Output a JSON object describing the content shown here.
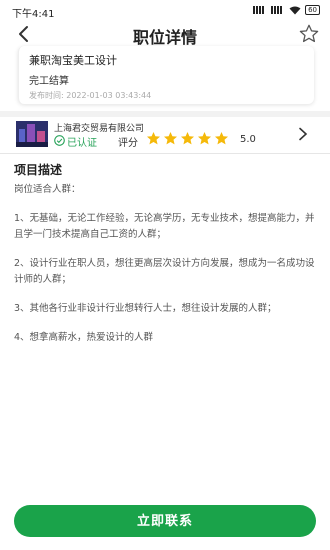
{
  "status_bar": {
    "time": "下午4:41",
    "battery": "60"
  },
  "nav": {
    "title": "职位详情"
  },
  "job": {
    "title": "兼职淘宝美工设计",
    "settlement": "完工结算",
    "published": "发布时间: 2022-01-03 03:43:44"
  },
  "company": {
    "name": "上海君交贸易有限公司",
    "verified_label": "已认证",
    "rating_label": "评分",
    "rating_value": "5.0",
    "rating_stars": 5
  },
  "description": {
    "title": "项目描述",
    "paragraphs": [
      "岗位适合人群：",
      "1、无基础，无论工作经验，无论高学历，无专业技术，想提高能力，并且学一门技术提高自己工资的人群；",
      "2、设计行业在职人员，想往更高层次设计方向发展，想成为一名成功设计师的人群；",
      "3、其他各行业非设计行业想转行人士，想往设计发展的人群；",
      "4、想拿高薪水，热爱设计的人群"
    ]
  },
  "actions": {
    "contact_label": "立即联系"
  },
  "colors": {
    "accent": "#1aa34a",
    "star": "#f5b90a"
  }
}
